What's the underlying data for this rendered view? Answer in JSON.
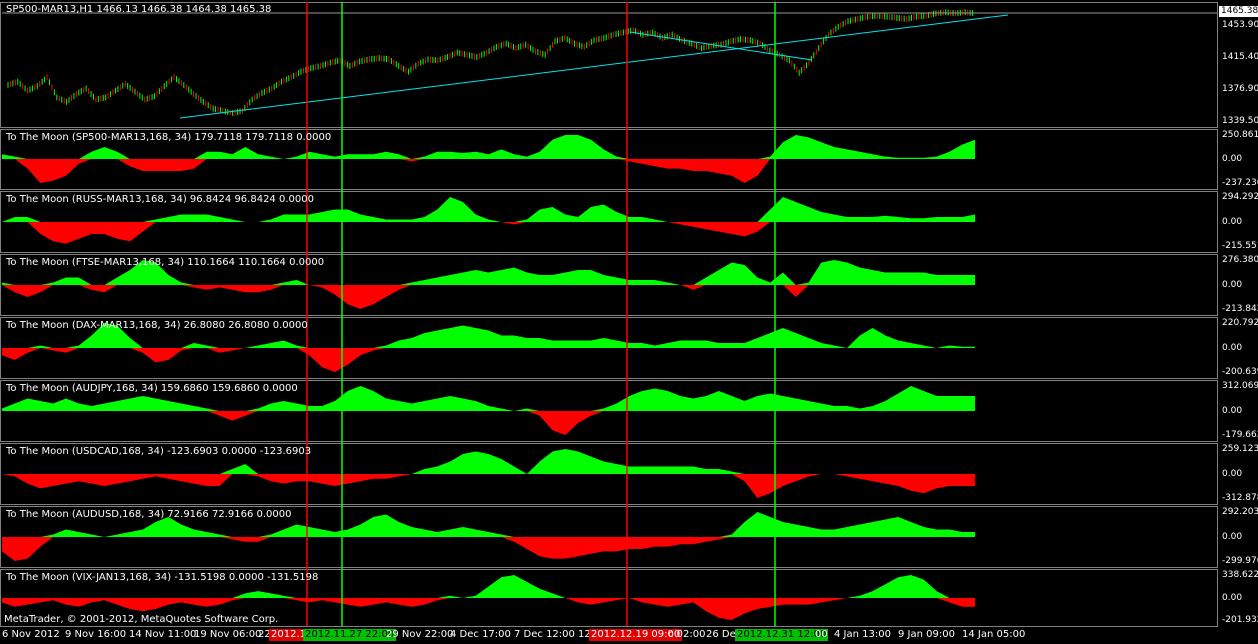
{
  "main": {
    "title": "SP500-MAR13,H1  1466.13 1466.38 1464.38 1465.38",
    "price_badge": "1465.38",
    "axis": [
      "1453.90",
      "1415.40",
      "1376.90",
      "1339.50"
    ],
    "candle_path": [
      0.67,
      0.64,
      0.72,
      0.68,
      0.6,
      0.78,
      0.82,
      0.75,
      0.7,
      0.8,
      0.78,
      0.72,
      0.66,
      0.73,
      0.8,
      0.77,
      0.68,
      0.6,
      0.67,
      0.75,
      0.82,
      0.88,
      0.9,
      0.92,
      0.9,
      0.8,
      0.74,
      0.7,
      0.64,
      0.6,
      0.55,
      0.52,
      0.5,
      0.47,
      0.45,
      0.5,
      0.46,
      0.44,
      0.43,
      0.44,
      0.5,
      0.55,
      0.48,
      0.44,
      0.45,
      0.42,
      0.38,
      0.4,
      0.42,
      0.38,
      0.33,
      0.3,
      0.34,
      0.31,
      0.37,
      0.4,
      0.28,
      0.25,
      0.3,
      0.33,
      0.27,
      0.25,
      0.22,
      0.2,
      0.18,
      0.22,
      0.2,
      0.25,
      0.22,
      0.27,
      0.3,
      0.34,
      0.32,
      0.31,
      0.28,
      0.26,
      0.27,
      0.3,
      0.36,
      0.4,
      0.45,
      0.56,
      0.47,
      0.34,
      0.22,
      0.15,
      0.1,
      0.08,
      0.06,
      0.05,
      0.06,
      0.07,
      0.08,
      0.06,
      0.05,
      0.03,
      0.02,
      0.03,
      0.02,
      0.03
    ]
  },
  "indicators": [
    {
      "title": "To The Moon (SP500-MAR13,168, 34) 179.7118 179.7118 0.0000",
      "top": "250.8617",
      "zero": "0.00",
      "bottom": "-237.236",
      "values": [
        0.2,
        0.1,
        -0.4,
        -1.0,
        -0.9,
        -0.7,
        -0.2,
        0.3,
        0.5,
        0.3,
        -0.3,
        -0.5,
        -0.5,
        -0.5,
        -0.5,
        -0.4,
        0.3,
        0.3,
        0.2,
        0.5,
        0.2,
        0.1,
        0.0,
        0.1,
        0.3,
        0.2,
        0.1,
        0.2,
        0.2,
        0.2,
        0.3,
        0.2,
        -0.1,
        0.1,
        0.3,
        0.3,
        0.25,
        0.3,
        0.2,
        0.4,
        0.2,
        0.1,
        0.3,
        0.8,
        1.0,
        1.0,
        0.8,
        0.4,
        0.1,
        -0.1,
        -0.2,
        -0.3,
        -0.4,
        -0.4,
        -0.5,
        -0.5,
        -0.6,
        -0.7,
        -1.0,
        -0.7,
        0.1,
        0.7,
        1.0,
        0.9,
        0.7,
        0.5,
        0.4,
        0.3,
        0.2,
        0.1,
        0.05,
        0.05,
        0.05,
        0.1,
        0.3,
        0.6,
        0.8
      ]
    },
    {
      "title": "To The Moon (RUSS-MAR13,168, 34) 96.8424 96.8424 0.0000",
      "top": "294.292",
      "zero": "0.00",
      "bottom": "-215.5517",
      "values": [
        0.0,
        0.2,
        0.2,
        -0.5,
        -0.8,
        -0.9,
        -0.7,
        -0.5,
        -0.5,
        -0.7,
        -0.8,
        -0.4,
        0.1,
        0.2,
        0.3,
        0.3,
        0.3,
        0.2,
        0.1,
        0.0,
        0.0,
        0.1,
        0.3,
        0.3,
        0.3,
        0.4,
        0.5,
        0.5,
        0.3,
        0.2,
        0.1,
        0.1,
        0.1,
        0.2,
        0.5,
        1.0,
        0.8,
        0.3,
        0.1,
        0.0,
        -0.1,
        0.1,
        0.5,
        0.6,
        0.3,
        0.2,
        0.6,
        0.7,
        0.4,
        0.2,
        0.2,
        0.1,
        0.0,
        -0.1,
        -0.2,
        -0.3,
        -0.4,
        -0.5,
        -0.6,
        -0.4,
        0.5,
        1.0,
        0.8,
        0.6,
        0.4,
        0.3,
        0.2,
        0.2,
        0.2,
        0.25,
        0.2,
        0.15,
        0.15,
        0.2,
        0.2,
        0.2,
        0.3
      ]
    },
    {
      "title": "To The Moon (FTSE-MAR13,168, 34) 110.1664 110.1664 0.0000",
      "top": "276.3803",
      "zero": "0.00",
      "bottom": "-213.8425",
      "values": [
        0.1,
        -0.3,
        -0.5,
        -0.3,
        0.1,
        0.3,
        0.3,
        -0.2,
        -0.3,
        0.3,
        0.6,
        1.0,
        0.9,
        0.4,
        0.1,
        -0.1,
        -0.2,
        -0.1,
        -0.2,
        -0.3,
        -0.3,
        -0.2,
        0.1,
        0.2,
        0.0,
        -0.1,
        -0.4,
        -0.8,
        -1.0,
        -0.8,
        -0.5,
        -0.2,
        0.1,
        0.2,
        0.3,
        0.4,
        0.5,
        0.6,
        0.5,
        0.6,
        0.7,
        0.5,
        0.4,
        0.4,
        0.5,
        0.6,
        0.6,
        0.4,
        0.3,
        0.2,
        0.2,
        0.2,
        0.1,
        0.0,
        -0.2,
        0.3,
        0.6,
        0.9,
        0.8,
        0.3,
        0.1,
        0.5,
        -0.5,
        0.1,
        0.9,
        1.0,
        0.9,
        0.7,
        0.6,
        0.5,
        0.5,
        0.5,
        0.5,
        0.4,
        0.4,
        0.4,
        0.4
      ]
    },
    {
      "title": "To The Moon (DAX-MAR13,168, 34) 26.8080 26.8080 0.0000",
      "top": "220.792",
      "zero": "0.00",
      "bottom": "-200.639",
      "values": [
        -0.3,
        -0.5,
        -0.2,
        0.1,
        -0.1,
        -0.2,
        0.1,
        0.5,
        1.0,
        0.9,
        0.4,
        -0.2,
        -0.6,
        -0.5,
        -0.1,
        0.2,
        0.1,
        -0.2,
        -0.1,
        0.0,
        0.1,
        0.2,
        0.3,
        0.1,
        -0.3,
        -0.8,
        -1.0,
        -0.7,
        -0.3,
        -0.1,
        0.1,
        0.3,
        0.4,
        0.6,
        0.7,
        0.8,
        0.9,
        0.8,
        0.7,
        0.5,
        0.5,
        0.4,
        0.4,
        0.3,
        0.3,
        0.3,
        0.3,
        0.4,
        0.3,
        0.2,
        0.2,
        0.1,
        0.2,
        0.3,
        0.3,
        0.3,
        0.2,
        0.2,
        0.2,
        0.4,
        0.6,
        0.8,
        0.6,
        0.4,
        0.2,
        0.1,
        0.0,
        0.5,
        0.8,
        0.5,
        0.3,
        0.2,
        0.1,
        0.0,
        0.1,
        0.05,
        0.05
      ]
    },
    {
      "title": "To The Moon (AUDJPY,168, 34) 159.6860 159.6860 0.0000",
      "top": "312.0697",
      "zero": "0.00",
      "bottom": "-179.662",
      "values": [
        0.1,
        0.3,
        0.5,
        0.4,
        0.3,
        0.5,
        0.3,
        0.2,
        0.3,
        0.4,
        0.5,
        0.6,
        0.5,
        0.4,
        0.3,
        0.2,
        0.1,
        -0.2,
        -0.4,
        -0.2,
        0.1,
        0.3,
        0.4,
        0.3,
        0.2,
        0.2,
        0.4,
        0.8,
        1.0,
        0.8,
        0.5,
        0.4,
        0.3,
        0.4,
        0.5,
        0.6,
        0.5,
        0.4,
        0.2,
        0.1,
        0.0,
        0.1,
        -0.2,
        -0.8,
        -1.0,
        -0.5,
        -0.2,
        0.1,
        0.3,
        0.6,
        0.8,
        0.9,
        0.8,
        0.6,
        0.5,
        0.6,
        0.8,
        0.6,
        0.4,
        0.6,
        0.7,
        0.6,
        0.5,
        0.4,
        0.3,
        0.2,
        0.2,
        0.1,
        0.2,
        0.4,
        0.7,
        1.0,
        0.8,
        0.6,
        0.6,
        0.6,
        0.6
      ]
    },
    {
      "title": "To The Moon (USDCAD,168, 34) -123.6903 0.0000 -123.6903",
      "top": "259.1238",
      "zero": "0.00",
      "bottom": "-312.878",
      "values": [
        0.0,
        -0.1,
        -0.4,
        -0.6,
        -0.5,
        -0.4,
        -0.3,
        -0.4,
        -0.5,
        -0.4,
        -0.3,
        -0.2,
        -0.1,
        -0.2,
        -0.3,
        -0.4,
        -0.5,
        -0.5,
        0.2,
        0.4,
        -0.1,
        -0.3,
        -0.4,
        -0.3,
        -0.3,
        -0.4,
        -0.5,
        -0.4,
        -0.3,
        -0.2,
        -0.2,
        -0.1,
        0.0,
        0.2,
        0.3,
        0.5,
        0.8,
        0.9,
        0.8,
        0.6,
        0.3,
        0.0,
        0.5,
        0.9,
        1.0,
        0.9,
        0.7,
        0.5,
        0.4,
        0.3,
        0.3,
        0.3,
        0.3,
        0.3,
        0.3,
        0.2,
        0.2,
        0.1,
        -0.3,
        -1.0,
        -0.8,
        -0.5,
        -0.3,
        -0.1,
        0.0,
        0.0,
        -0.1,
        -0.2,
        -0.3,
        -0.4,
        -0.5,
        -0.7,
        -0.8,
        -0.6,
        -0.5,
        -0.5,
        -0.5
      ]
    },
    {
      "title": "To The Moon (AUDUSD,168, 34) 72.9166 72.9166 0.0000",
      "top": "292.2036",
      "zero": "0.00",
      "bottom": "-299.976",
      "values": [
        -0.6,
        -1.0,
        -0.9,
        -0.4,
        0.1,
        0.3,
        0.2,
        0.1,
        0.0,
        0.1,
        0.2,
        0.3,
        0.6,
        0.8,
        0.5,
        0.3,
        0.2,
        0.1,
        -0.1,
        -0.2,
        -0.2,
        0.1,
        0.3,
        0.5,
        0.4,
        0.3,
        0.2,
        0.3,
        0.5,
        0.8,
        0.9,
        0.6,
        0.4,
        0.3,
        0.2,
        0.3,
        0.4,
        0.3,
        0.2,
        0.1,
        -0.2,
        -0.5,
        -0.8,
        -0.9,
        -0.9,
        -0.8,
        -0.7,
        -0.6,
        -0.6,
        -0.5,
        -0.5,
        -0.4,
        -0.4,
        -0.3,
        -0.3,
        -0.2,
        -0.1,
        0.1,
        0.6,
        1.0,
        0.8,
        0.6,
        0.5,
        0.4,
        0.3,
        0.3,
        0.4,
        0.5,
        0.6,
        0.7,
        0.8,
        0.6,
        0.4,
        0.3,
        0.3,
        0.2,
        0.2
      ]
    },
    {
      "title": "To The Moon (VIX-JAN13,168, 34) -131.5198 0.0000 -131.5198",
      "top": "338.6225",
      "zero": "0.00",
      "bottom": "-201.932",
      "values": [
        -0.2,
        -0.4,
        -0.3,
        -0.2,
        -0.1,
        -0.3,
        -0.4,
        -0.2,
        -0.1,
        -0.3,
        -0.5,
        -0.6,
        -0.5,
        -0.3,
        -0.2,
        -0.3,
        -0.4,
        -0.3,
        -0.1,
        0.2,
        0.3,
        0.2,
        0.1,
        -0.1,
        -0.2,
        -0.1,
        -0.2,
        -0.3,
        -0.4,
        -0.3,
        -0.2,
        -0.3,
        -0.4,
        -0.3,
        -0.1,
        0.1,
        0.0,
        0.1,
        0.5,
        0.9,
        1.0,
        0.7,
        0.4,
        0.2,
        0.0,
        -0.2,
        -0.3,
        -0.2,
        -0.1,
        0.0,
        -0.2,
        -0.3,
        -0.4,
        -0.3,
        -0.2,
        -0.6,
        -0.9,
        -1.0,
        -0.7,
        -0.5,
        -0.4,
        -0.3,
        -0.3,
        -0.3,
        -0.2,
        -0.1,
        0.0,
        0.1,
        0.3,
        0.6,
        0.9,
        1.0,
        0.8,
        0.3,
        -0.2,
        -0.4,
        -0.4
      ]
    }
  ],
  "time_axis": {
    "labels": [
      "6 Nov 2012",
      "9 Nov 16:00",
      "14 Nov 11:00",
      "19 Nov 06:00",
      "22",
      "29 Nov 22:00",
      "4 Dec 17:00",
      "7 Dec 12:00",
      "12",
      "c 02:00",
      "26 Dec",
      "00",
      "4 Jan 13:00",
      "9 Jan 09:00",
      "14 Jan 05:00"
    ],
    "red_marker_left": "2012.1",
    "green_marker_left": "2012.11.27 22:00",
    "red_marker_right": "2012.12.19 09:00",
    "green_marker_right": "2012.12.31 12:00"
  },
  "colors": {
    "positive": "#00ff00",
    "negative": "#ff0000",
    "red_line": "#ff0000",
    "green_line": "#00ff00",
    "trend_line": "#00e5ee",
    "border": "#808080"
  },
  "copyright": "MetaTrader, © 2001-2012, MetaQuotes Software Corp."
}
